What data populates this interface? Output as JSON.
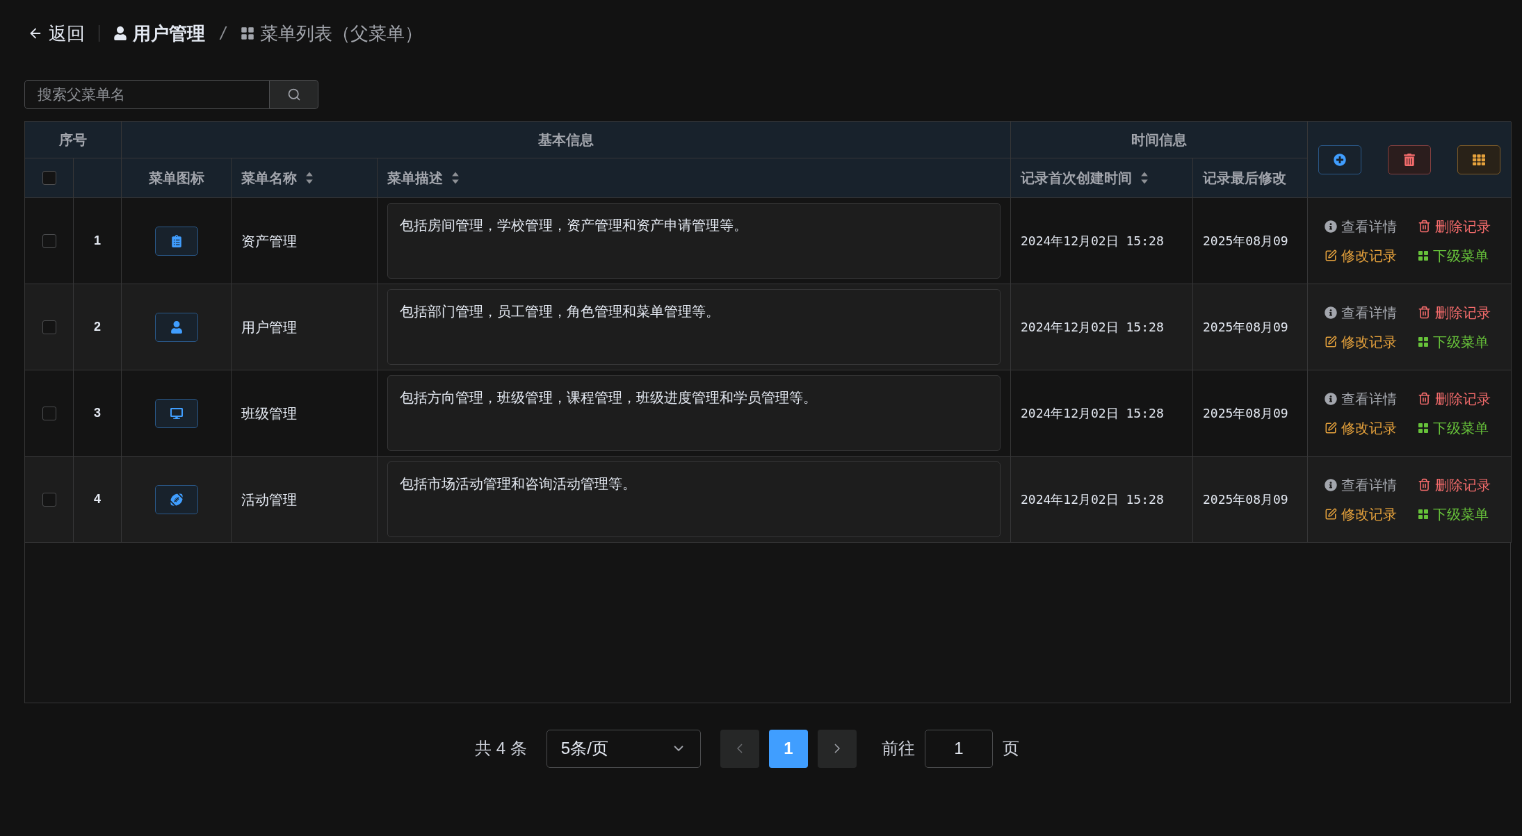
{
  "header": {
    "back": "返回",
    "breadcrumbs": [
      {
        "label": "用户管理",
        "current": false
      },
      {
        "label": "菜单列表（父菜单）",
        "current": true
      }
    ],
    "separator": "/"
  },
  "search": {
    "placeholder": "搜索父菜单名"
  },
  "table": {
    "groups": [
      {
        "label": "序号"
      },
      {
        "label": "基本信息"
      },
      {
        "label": "时间信息"
      }
    ],
    "select_all": {
      "checked": false
    },
    "columns": [
      {
        "label": "菜单图标",
        "sortable": false
      },
      {
        "label": "菜单名称",
        "sortable": true
      },
      {
        "label": "菜单描述",
        "sortable": true
      },
      {
        "label": "记录首次创建时间",
        "sortable": true
      },
      {
        "label": "记录最后修改",
        "sortable": false
      }
    ],
    "rows": [
      {
        "index": "1",
        "checked": false,
        "name": "资产管理",
        "description": "包括房间管理，学校管理，资产管理和资产申请管理等。",
        "created": "2024年12月02日 15:28",
        "modified": "2025年08月09",
        "actions": [
          {
            "kind": "view",
            "label": "查看详情"
          },
          {
            "kind": "delete",
            "label": "删除记录"
          },
          {
            "kind": "edit",
            "label": "修改记录"
          },
          {
            "kind": "children",
            "label": "下级菜单"
          }
        ]
      },
      {
        "index": "2",
        "checked": false,
        "name": "用户管理",
        "description": "包括部门管理，员工管理，角色管理和菜单管理等。",
        "created": "2024年12月02日 15:28",
        "modified": "2025年08月09",
        "actions": [
          {
            "kind": "view",
            "label": "查看详情"
          },
          {
            "kind": "delete",
            "label": "删除记录"
          },
          {
            "kind": "edit",
            "label": "修改记录"
          },
          {
            "kind": "children",
            "label": "下级菜单"
          }
        ]
      },
      {
        "index": "3",
        "checked": false,
        "name": "班级管理",
        "description": "包括方向管理，班级管理，课程管理，班级进度管理和学员管理等。",
        "created": "2024年12月02日 15:28",
        "modified": "2025年08月09",
        "actions": [
          {
            "kind": "view",
            "label": "查看详情"
          },
          {
            "kind": "delete",
            "label": "删除记录"
          },
          {
            "kind": "edit",
            "label": "修改记录"
          },
          {
            "kind": "children",
            "label": "下级菜单"
          }
        ]
      },
      {
        "index": "4",
        "checked": false,
        "name": "活动管理",
        "description": "包括市场活动管理和咨询活动管理等。",
        "created": "2024年12月02日 15:28",
        "modified": "2025年08月09",
        "actions": [
          {
            "kind": "view",
            "label": "查看详情"
          },
          {
            "kind": "delete",
            "label": "删除记录"
          },
          {
            "kind": "edit",
            "label": "修改记录"
          },
          {
            "kind": "children",
            "label": "下级菜单"
          }
        ]
      }
    ]
  },
  "pagination": {
    "total": "共 4 条",
    "page_size": "5条/页",
    "pages": [
      {
        "label": "1",
        "selected": true
      }
    ],
    "goto_label": "前往",
    "goto_value": "1",
    "page_suffix": "页"
  }
}
